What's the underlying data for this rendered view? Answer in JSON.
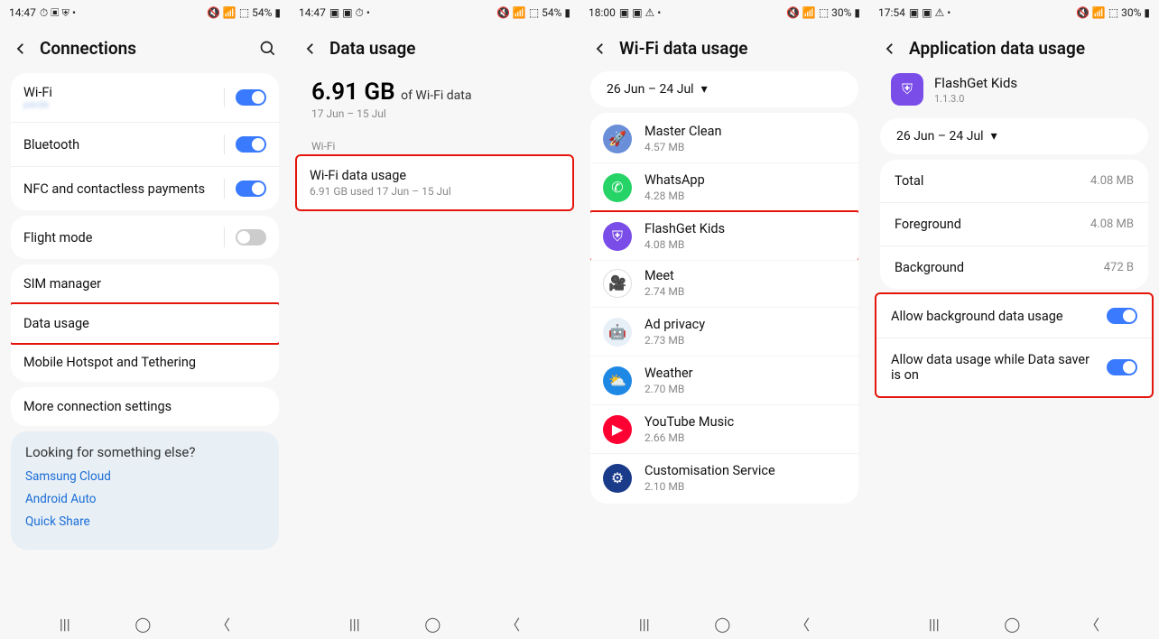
{
  "screens": [
    {
      "status": {
        "time": "14:47",
        "icons_left": "⏱ ▣ ⛨ •",
        "icons_right": "🔇 📶 ⬚ 54% ▮"
      },
      "title": "Connections",
      "has_search": true,
      "groups": [
        {
          "rows": [
            {
              "label": "Wi-Fi",
              "sub_blur": "panda",
              "toggle": true,
              "on": true,
              "name": "wifi-row"
            },
            {
              "label": "Bluetooth",
              "toggle": true,
              "on": true,
              "name": "bluetooth-row"
            },
            {
              "label": "NFC and contactless payments",
              "toggle": true,
              "on": true,
              "name": "nfc-row"
            }
          ]
        },
        {
          "rows": [
            {
              "label": "Flight mode",
              "toggle": true,
              "on": false,
              "name": "flight-mode-row"
            }
          ]
        },
        {
          "rows": [
            {
              "label": "SIM manager",
              "name": "sim-manager-row"
            },
            {
              "label": "Data usage",
              "highlight": true,
              "name": "data-usage-row"
            },
            {
              "label": "Mobile Hotspot and Tethering",
              "name": "hotspot-row"
            }
          ]
        },
        {
          "rows": [
            {
              "label": "More connection settings",
              "name": "more-connection-row"
            }
          ]
        }
      ],
      "help": {
        "q": "Looking for something else?",
        "links": [
          "Samsung Cloud",
          "Android Auto",
          "Quick Share"
        ]
      }
    },
    {
      "status": {
        "time": "14:47",
        "icons_left": "▣ ▣ ⏱ •",
        "icons_right": "🔇 📶 ⬚ 54% ▮"
      },
      "title": "Data usage",
      "big": {
        "value": "6.91 GB",
        "unit": "of Wi-Fi data",
        "range": "17 Jun – 15 Jul"
      },
      "section": "Wi-Fi",
      "wifi_row": {
        "label": "Wi-Fi data usage",
        "sub": "6.91 GB used 17 Jun – 15 Jul",
        "highlight": true
      }
    },
    {
      "status": {
        "time": "18:00",
        "icons_left": "▣ ▣ ⚠ •",
        "icons_right": "🔇 📶 ⬚ 30% ▮"
      },
      "title": "Wi-Fi data usage",
      "range": "26 Jun – 24 Jul",
      "apps": [
        {
          "name": "Master Clean",
          "size": "4.57 MB",
          "bg": "#6a8fd8",
          "glyph": "🚀"
        },
        {
          "name": "WhatsApp",
          "size": "4.28 MB",
          "bg": "#25d366",
          "glyph": "✆"
        },
        {
          "name": "FlashGet Kids",
          "size": "4.08 MB",
          "bg": "#7a4de8",
          "glyph": "⛨",
          "highlight": true
        },
        {
          "name": "Meet",
          "size": "2.74 MB",
          "bg": "#fff",
          "glyph": "🎥",
          "border": true
        },
        {
          "name": "Ad privacy",
          "size": "2.73 MB",
          "bg": "#e8f0f7",
          "glyph": "🤖",
          "fg": "#3ddc84"
        },
        {
          "name": "Weather",
          "size": "2.70 MB",
          "bg": "#1e88e5",
          "glyph": "⛅"
        },
        {
          "name": "YouTube Music",
          "size": "2.66 MB",
          "bg": "#ff0033",
          "glyph": "▶"
        },
        {
          "name": "Customisation Service",
          "size": "2.10 MB",
          "bg": "#1a3a8a",
          "glyph": "⚙"
        }
      ]
    },
    {
      "status": {
        "time": "17:54",
        "icons_left": "▣ ▣ ⚠ •",
        "icons_right": "🔇 📶 ⬚ 30% ▮"
      },
      "title": "Application data usage",
      "app": {
        "name": "FlashGet Kids",
        "ver": "1.1.3.0"
      },
      "range": "26 Jun – 24 Jul",
      "stats": [
        {
          "label": "Total",
          "val": "4.08 MB"
        },
        {
          "label": "Foreground",
          "val": "4.08 MB"
        },
        {
          "label": "Background",
          "val": "472 B"
        }
      ],
      "switches": [
        {
          "label": "Allow background data usage",
          "on": true,
          "name": "allow-bg-data-toggle"
        },
        {
          "label": "Allow data usage while Data saver is on",
          "on": true,
          "name": "allow-data-saver-toggle"
        }
      ],
      "switches_highlight": true
    }
  ],
  "nav": {
    "recent": "|||",
    "home": "◯",
    "back": "〈"
  }
}
